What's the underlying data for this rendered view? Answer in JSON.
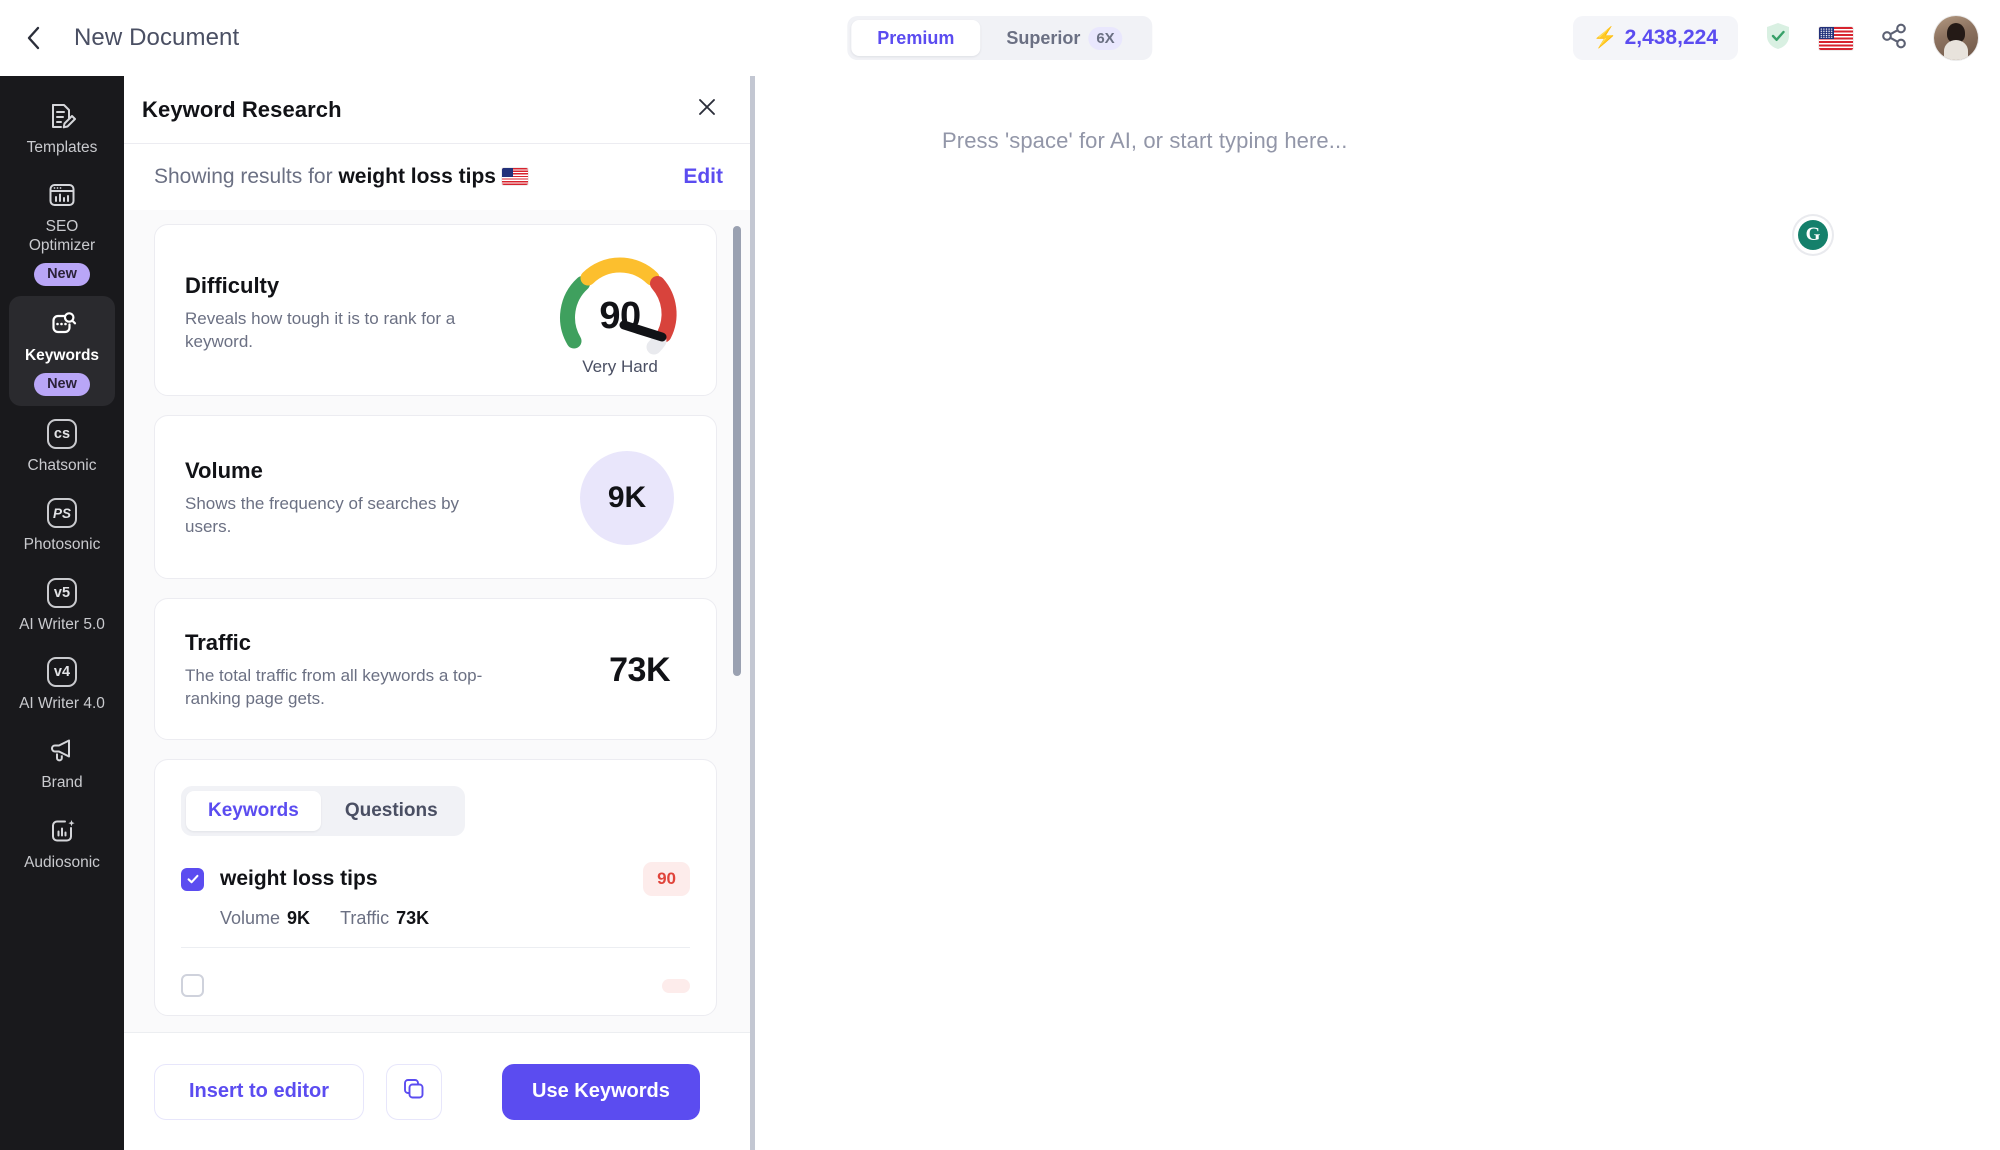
{
  "topbar": {
    "back_icon": "chevron-left-icon",
    "document_title": "New Document",
    "mode_switch": {
      "options": [
        {
          "label": "Premium",
          "badge": "",
          "active": true
        },
        {
          "label": "Superior",
          "badge": "6X",
          "active": false
        }
      ]
    },
    "credits": {
      "icon": "bolt-icon",
      "value": "2,438,224"
    },
    "plagiarism_icon": "shield-check-icon",
    "language_icon": "us-flag-icon",
    "share_icon": "share-icon",
    "avatar": "user-avatar"
  },
  "sidebar": {
    "items": [
      {
        "label": "Templates",
        "icon": "document-edit-icon",
        "badge": "",
        "active": false
      },
      {
        "label": "SEO Optimizer",
        "icon": "seo-chart-window-icon",
        "badge": "New",
        "active": false
      },
      {
        "label": "Keywords",
        "icon": "keyword-search-icon",
        "badge": "New",
        "active": true
      },
      {
        "label": "Chatsonic",
        "icon": "cs-icon",
        "badge": "",
        "active": false
      },
      {
        "label": "Photosonic",
        "icon": "ps-icon",
        "badge": "",
        "active": false
      },
      {
        "label": "AI Writer 5.0",
        "icon": "v5-icon",
        "badge": "",
        "active": false
      },
      {
        "label": "AI Writer 4.0",
        "icon": "v4-icon",
        "badge": "",
        "active": false
      },
      {
        "label": "Brand",
        "icon": "megaphone-icon",
        "badge": "",
        "active": false
      },
      {
        "label": "Audiosonic",
        "icon": "audio-bars-icon",
        "badge": "",
        "active": false
      }
    ]
  },
  "panel": {
    "title": "Keyword Research",
    "close_icon": "close-icon",
    "results_prefix": "Showing results for",
    "results_keyword": "weight loss tips",
    "results_flag": "us-flag-icon",
    "edit_label": "Edit",
    "cards": {
      "difficulty": {
        "title": "Difficulty",
        "description": "Reveals how tough it is to rank for a keyword.",
        "value": "90",
        "rating": "Very Hard"
      },
      "volume": {
        "title": "Volume",
        "description": "Shows the frequency of searches by users.",
        "value": "9K"
      },
      "traffic": {
        "title": "Traffic",
        "description": "The total traffic from all keywords a top-ranking page gets.",
        "value": "73K"
      }
    },
    "tabs": [
      {
        "label": "Keywords",
        "active": true
      },
      {
        "label": "Questions",
        "active": false
      }
    ],
    "keyword_rows": [
      {
        "name": "weight loss tips",
        "checked": true,
        "difficulty": "90",
        "volume_label": "Volume",
        "volume_value": "9K",
        "traffic_label": "Traffic",
        "traffic_value": "73K"
      }
    ],
    "footer": {
      "insert_label": "Insert to editor",
      "copy_icon": "copy-icon",
      "use_label": "Use Keywords"
    },
    "scrollbar": "panel-scrollbar",
    "resizer": "panel-resize-handle"
  },
  "editor": {
    "placeholder": "Press 'space' for AI, or start typing here...",
    "grammarly_icon": "grammarly-icon",
    "grammarly_letter": "G"
  },
  "colors": {
    "accent": "#5b4cf0",
    "sidebar_bg": "#19191c",
    "badge_purple": "#b9a6f7",
    "difficulty_red": "#e0443b",
    "gauge_green": "#3fa05e",
    "gauge_yellow": "#fcbf2e",
    "gauge_red": "#d8433c",
    "grammarly_green": "#15806b"
  }
}
